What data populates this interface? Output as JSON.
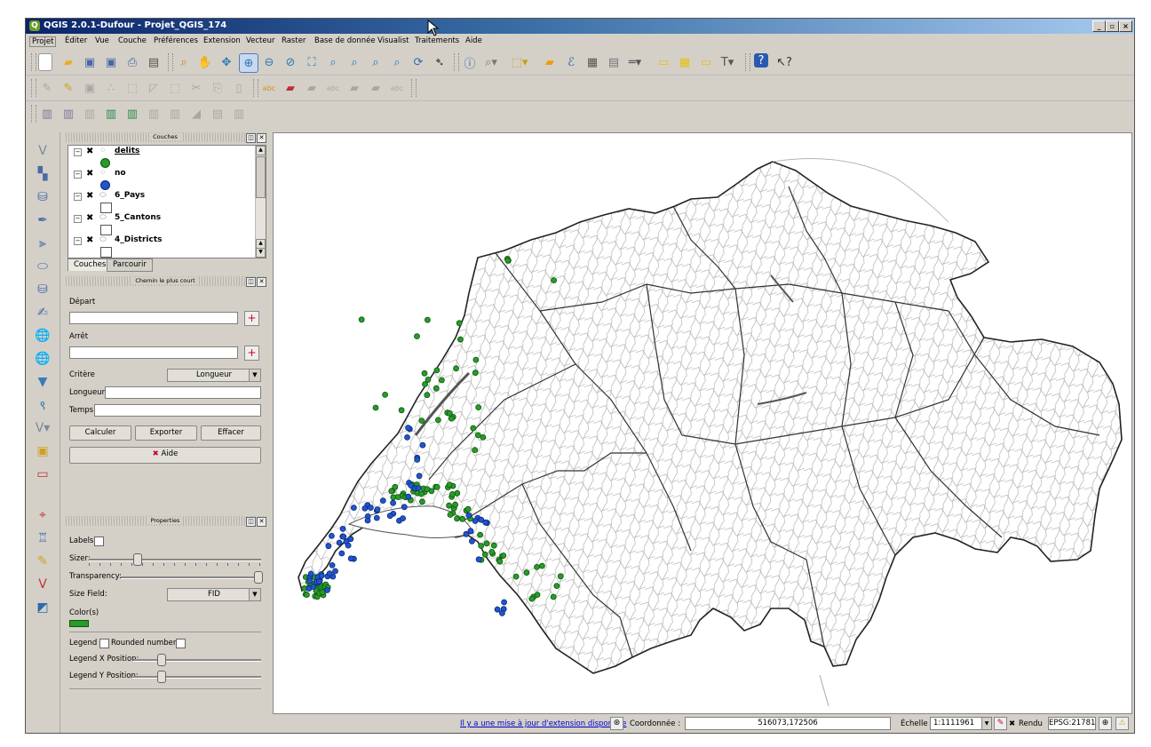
{
  "window": {
    "title": "QGIS 2.0.1-Dufour - Projet_QGIS_174",
    "app_glyph": "Q"
  },
  "menu": [
    "Projet",
    "Éditer",
    "Vue",
    "Couche",
    "Préférences",
    "Extension",
    "Vecteur",
    "Raster",
    "Base de donnée",
    "Visualist",
    "Traitements",
    "Aide"
  ],
  "layers_panel": {
    "title": "Couches",
    "layers": [
      {
        "name": "delits",
        "checked": "✖",
        "symbol": "point",
        "color": "#2a9a2a"
      },
      {
        "name": "no",
        "checked": "✖",
        "symbol": "point",
        "color": "#2255cc"
      },
      {
        "name": "6_Pays",
        "checked": "✖",
        "symbol": "polygon"
      },
      {
        "name": "5_Cantons",
        "checked": "✖",
        "symbol": "polygon"
      },
      {
        "name": "4_Districts",
        "checked": "✖",
        "symbol": "polygon"
      }
    ],
    "tabs": [
      "Couches",
      "Parcourir"
    ]
  },
  "route_panel": {
    "title": "Chemin le plus court",
    "depart_label": "Départ",
    "arret_label": "Arrêt",
    "critere_label": "Critère",
    "critere_value": "Longueur",
    "longueur_label": "Longueur",
    "temps_label": "Temps",
    "calc_button": "Calculer",
    "export_button": "Exporter",
    "clear_button": "Effacer",
    "help_button": "Aide"
  },
  "properties_panel": {
    "title": "Properties",
    "labels_label": "Labels",
    "sizer_label": "Sizer:",
    "sizer_value": 0.28,
    "transparency_label": "Transparency:",
    "transparency_value": 1.0,
    "size_field_label": "Size Field:",
    "size_field_value": "FID",
    "colors_label": "Color(s)",
    "swatch_color": "#2a9a2a",
    "legend_label": "Legend",
    "rounded_label": "Rounded numbers",
    "legend_x_label": "Legend X Position:",
    "legend_y_label": "Legend Y Position:"
  },
  "statusbar": {
    "update_link": "Il y a une mise à jour d'extension disponible",
    "coord_label": "Coordonnée :",
    "coord_value": "516073,172506",
    "scale_label": "Échelle",
    "scale_value": "1:1111961",
    "render_check": "✖",
    "render_label": "Rendu",
    "crs": "EPSG:21781"
  },
  "colors": {
    "green_points": "#2a9a2a",
    "blue_points": "#2255cc",
    "accent": "#0a246a"
  },
  "toolbar_icons": [
    "new-icon",
    "open-icon",
    "save-icon",
    "save-as-icon",
    "print-icon",
    "composer-icon",
    "pan-icon",
    "pan-selection-icon",
    "zoom-in-icon",
    "zoom-out-icon",
    "zoom-full-icon",
    "zoom-layer-icon",
    "zoom-last-icon",
    "refresh-icon",
    "identify-icon",
    "measure-icon",
    "select-icon",
    "field-calc-icon",
    "attribute-table-icon",
    "tips-icon",
    "help-icon"
  ]
}
